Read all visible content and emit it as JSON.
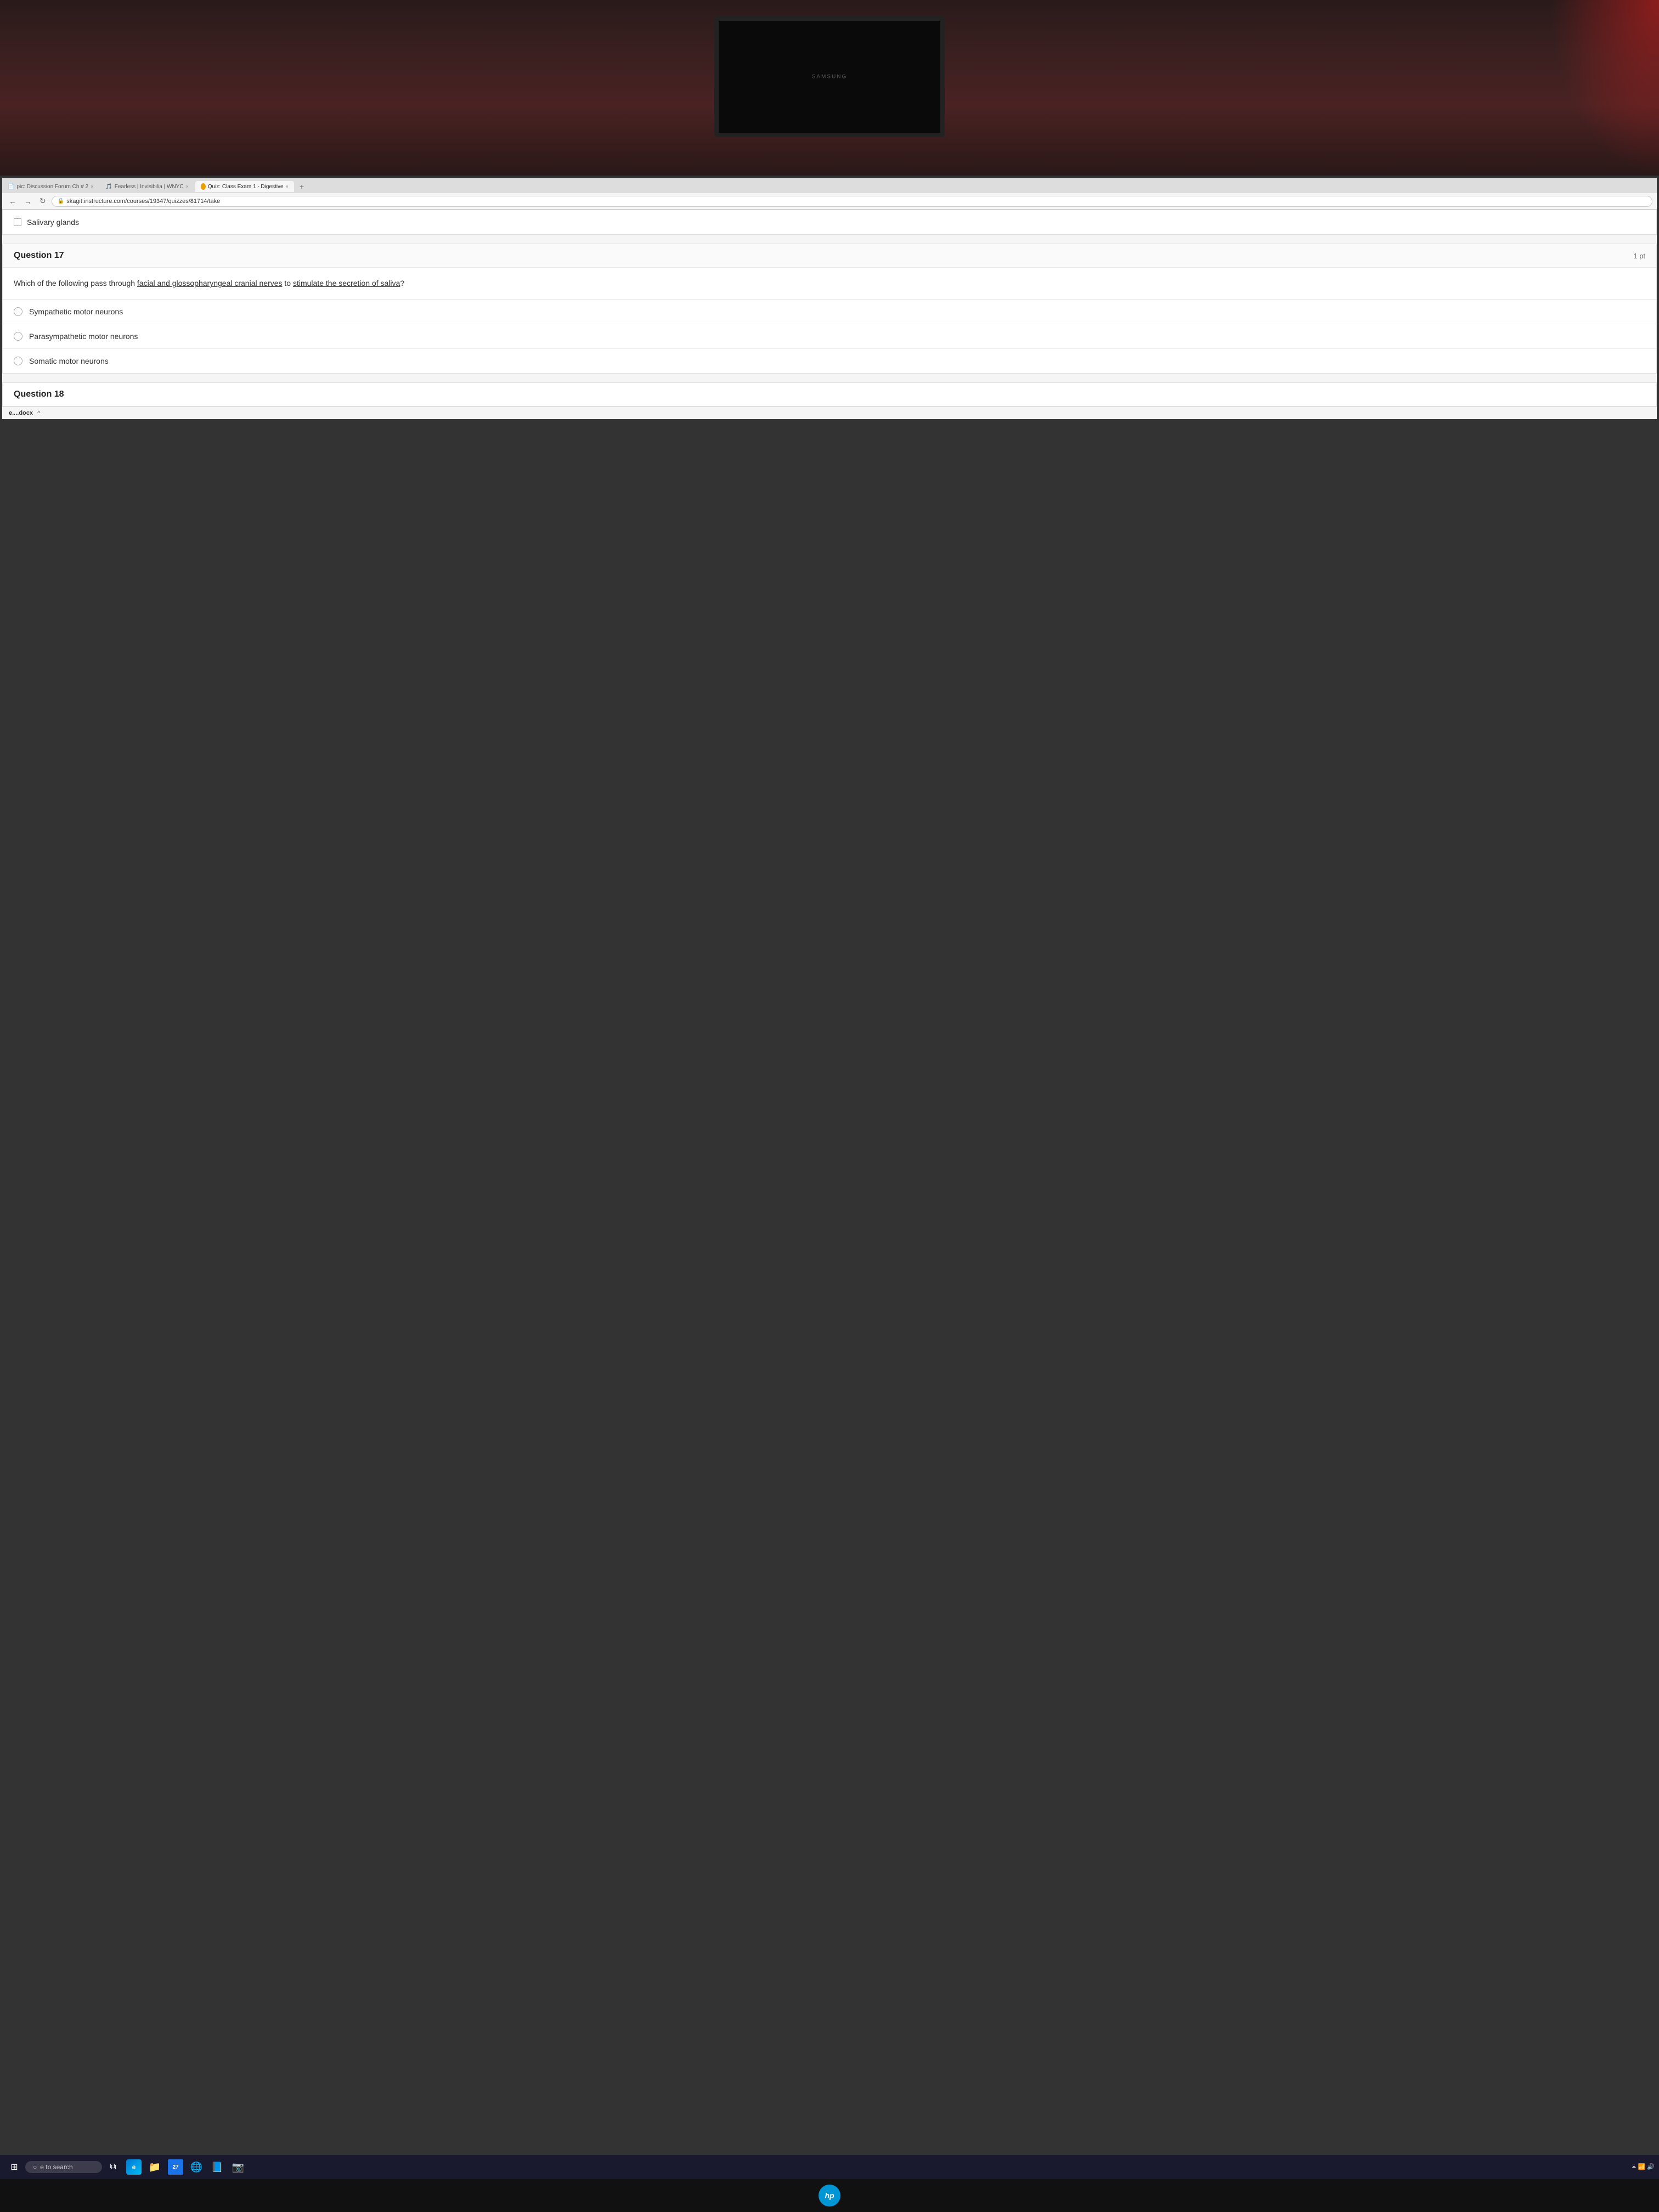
{
  "environment": {
    "tv_brand": "SAMSUNG",
    "red_glow": true
  },
  "browser": {
    "tabs": [
      {
        "id": "tab1",
        "label": "pic: Discussion Forum Ch # 2",
        "active": false,
        "favicon": "📄"
      },
      {
        "id": "tab2",
        "label": "Fearless | Invisibilia | WNYC",
        "active": false,
        "favicon": "🎵"
      },
      {
        "id": "tab3",
        "label": "Quiz: Class Exam 1 - Digestive",
        "active": true,
        "favicon": "🔶"
      }
    ],
    "address": "skagit.instructure.com/courses/19347/quizzes/81714/take",
    "lock_icon": "🔒"
  },
  "quiz": {
    "previous_section": {
      "checkbox_label": "Salivary glands"
    },
    "question17": {
      "number": "Question 17",
      "points": "1",
      "question_text_part1": "Which of the following pass through ",
      "question_link1": "facial and glossopharyngeal cranial nerves",
      "question_text_part2": " to ",
      "question_link2": "stimulate the secretion of saliva",
      "question_text_end": "?",
      "answers": [
        {
          "id": "a1",
          "label": "Sympathetic motor neurons"
        },
        {
          "id": "a2",
          "label": "Parasympathetic motor neurons"
        },
        {
          "id": "a3",
          "label": "Somatic motor neurons"
        }
      ]
    },
    "question18": {
      "number": "Question 18"
    }
  },
  "download_bar": {
    "filename": "e....docx",
    "chevron": "^"
  },
  "taskbar": {
    "search_placeholder": "e to search",
    "search_icon": "○",
    "icons": [
      "⊞",
      "🔍"
    ],
    "date": "27"
  },
  "hp": {
    "label": "hp"
  }
}
